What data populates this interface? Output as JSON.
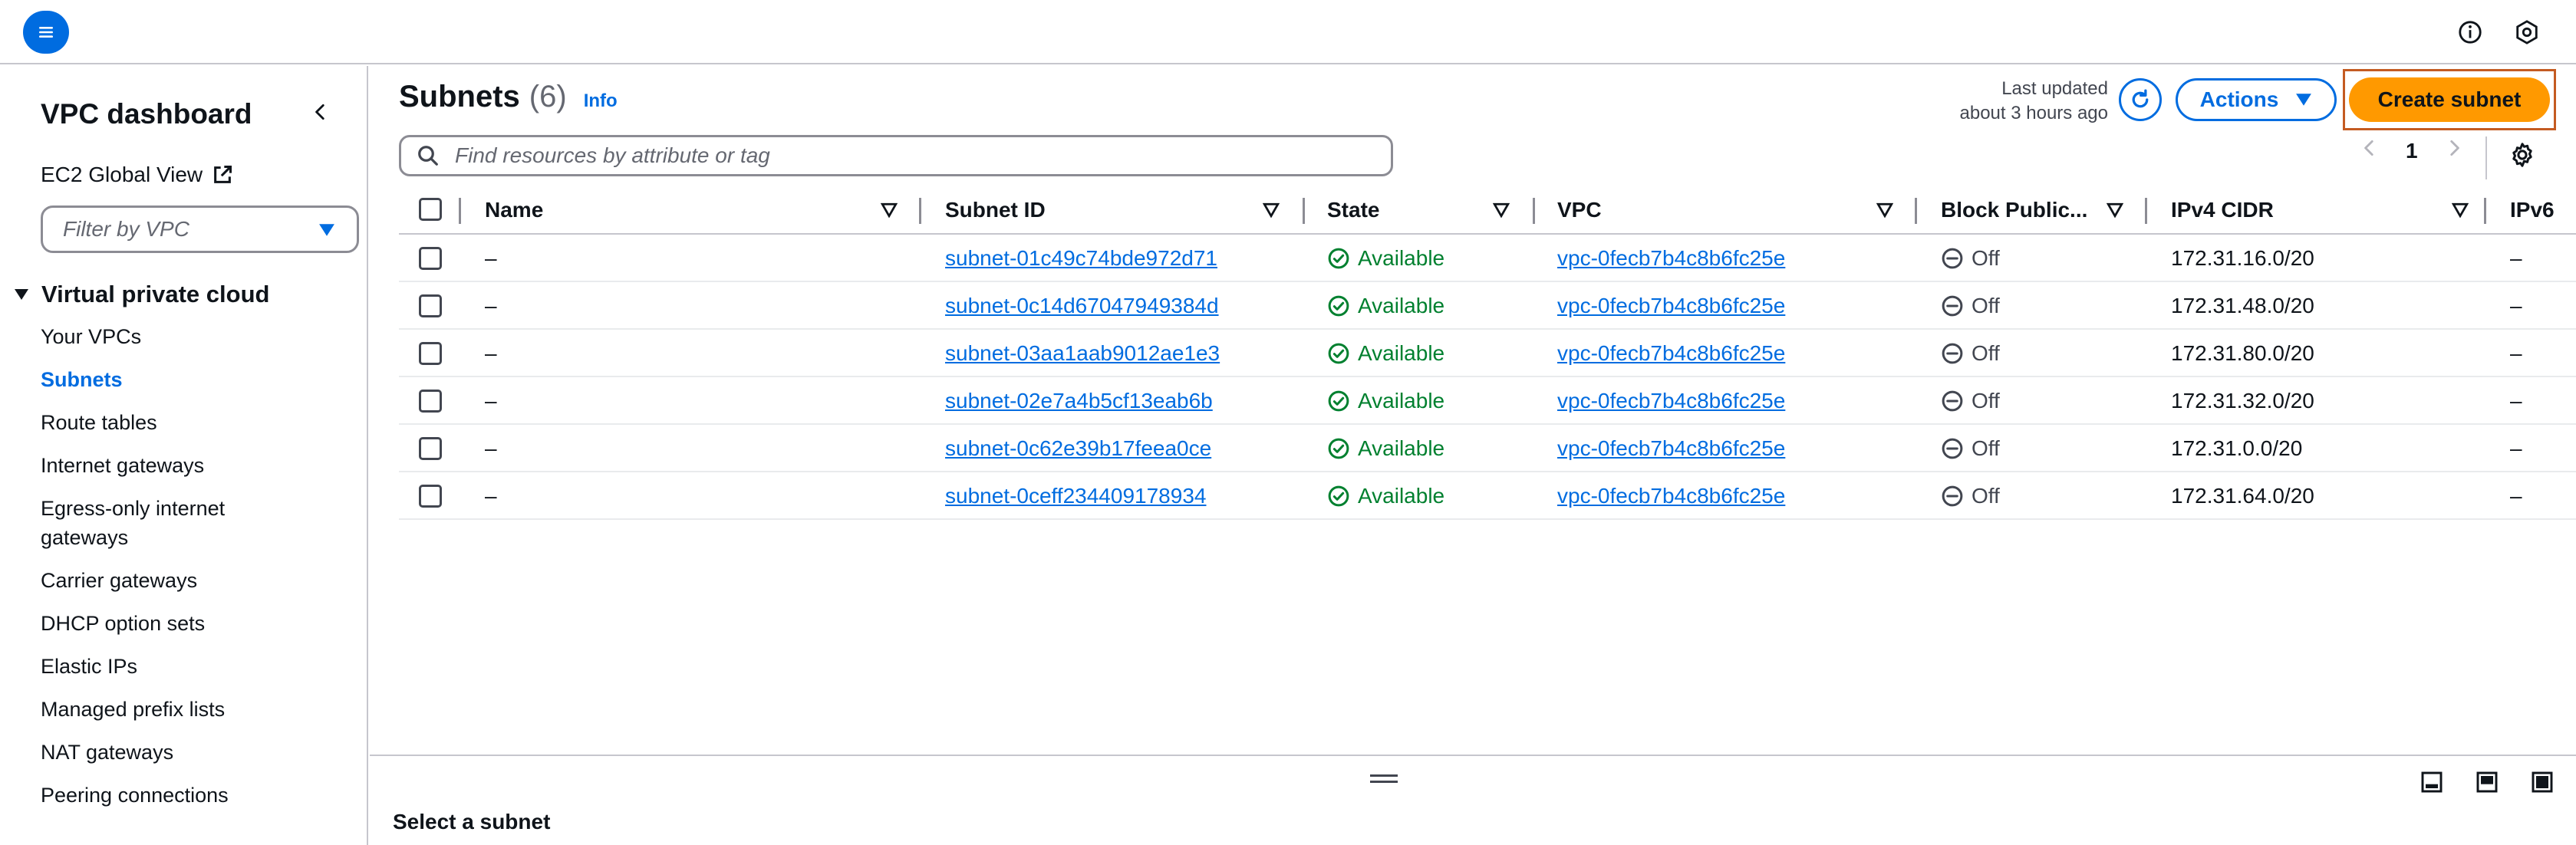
{
  "topbar": {
    "menu_icon": "hamburger-menu-icon",
    "info_icon": "info-circle-icon",
    "settings_icon": "hexagon-settings-icon"
  },
  "sidebar": {
    "title": "VPC dashboard",
    "ec2_global_view": "EC2 Global View",
    "filter_placeholder": "Filter by VPC",
    "section": "Virtual private cloud",
    "items": [
      {
        "label": "Your VPCs",
        "active": false
      },
      {
        "label": "Subnets",
        "active": true
      },
      {
        "label": "Route tables",
        "active": false
      },
      {
        "label": "Internet gateways",
        "active": false
      },
      {
        "label": "Egress-only internet gateways",
        "active": false
      },
      {
        "label": "Carrier gateways",
        "active": false
      },
      {
        "label": "DHCP option sets",
        "active": false
      },
      {
        "label": "Elastic IPs",
        "active": false
      },
      {
        "label": "Managed prefix lists",
        "active": false
      },
      {
        "label": "NAT gateways",
        "active": false
      },
      {
        "label": "Peering connections",
        "active": false
      }
    ]
  },
  "header": {
    "title": "Subnets",
    "count": "(6)",
    "info": "Info",
    "last_updated_line1": "Last updated",
    "last_updated_line2": "about 3 hours ago",
    "actions_label": "Actions",
    "create_label": "Create subnet"
  },
  "search": {
    "placeholder": "Find resources by attribute or tag"
  },
  "pagination": {
    "current_page": "1"
  },
  "table": {
    "columns": [
      "Name",
      "Subnet ID",
      "State",
      "VPC",
      "Block Public...",
      "IPv4 CIDR",
      "IPv6"
    ],
    "rows": [
      {
        "name": "–",
        "subnet_id": "subnet-01c49c74bde972d71",
        "state": "Available",
        "vpc": "vpc-0fecb7b4c8b6fc25e",
        "block": "Off",
        "ipv4": "172.31.16.0/20",
        "ipv6": "–"
      },
      {
        "name": "–",
        "subnet_id": "subnet-0c14d67047949384d",
        "state": "Available",
        "vpc": "vpc-0fecb7b4c8b6fc25e",
        "block": "Off",
        "ipv4": "172.31.48.0/20",
        "ipv6": "–"
      },
      {
        "name": "–",
        "subnet_id": "subnet-03aa1aab9012ae1e3",
        "state": "Available",
        "vpc": "vpc-0fecb7b4c8b6fc25e",
        "block": "Off",
        "ipv4": "172.31.80.0/20",
        "ipv6": "–"
      },
      {
        "name": "–",
        "subnet_id": "subnet-02e7a4b5cf13eab6b",
        "state": "Available",
        "vpc": "vpc-0fecb7b4c8b6fc25e",
        "block": "Off",
        "ipv4": "172.31.32.0/20",
        "ipv6": "–"
      },
      {
        "name": "–",
        "subnet_id": "subnet-0c62e39b17feea0ce",
        "state": "Available",
        "vpc": "vpc-0fecb7b4c8b6fc25e",
        "block": "Off",
        "ipv4": "172.31.0.0/20",
        "ipv6": "–"
      },
      {
        "name": "–",
        "subnet_id": "subnet-0ceff234409178934",
        "state": "Available",
        "vpc": "vpc-0fecb7b4c8b6fc25e",
        "block": "Off",
        "ipv4": "172.31.64.0/20",
        "ipv6": "–"
      }
    ]
  },
  "split_panel": {
    "title": "Select a subnet"
  },
  "colors": {
    "accent": "#006ce0",
    "primary_button": "#ff9900",
    "success": "#00802f",
    "highlight_outline": "#c45b22"
  }
}
